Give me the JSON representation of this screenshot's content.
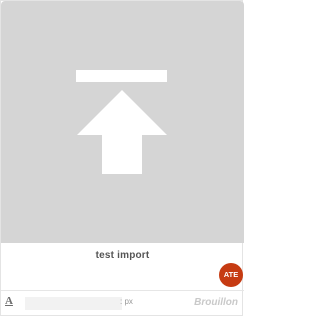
{
  "card": {
    "title": "test import",
    "avatar_initials": "ATE",
    "avatar_color": "#c63b12",
    "thumbnail_icon": "upload-arrow-icon",
    "thumbnail_background": "#d5d5d5"
  },
  "footer": {
    "text_icon": "A",
    "size_value": "",
    "unit": ": px",
    "status": "Brouillon"
  }
}
